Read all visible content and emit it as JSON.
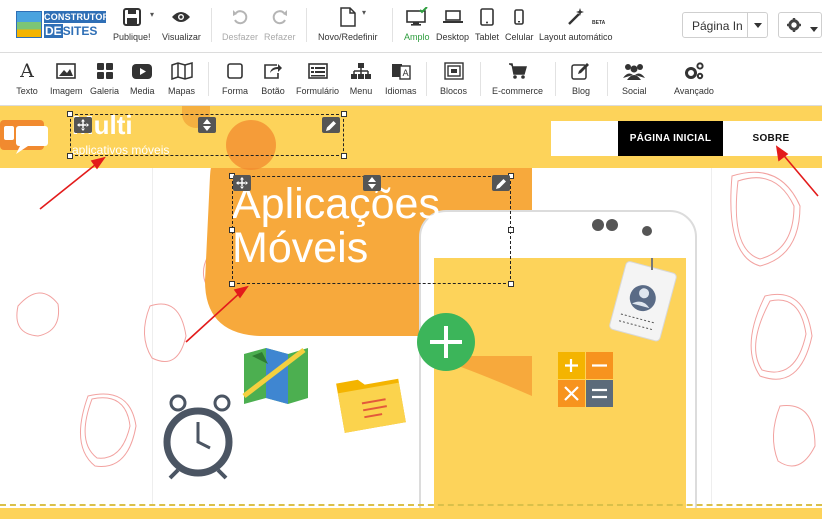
{
  "brand": {
    "line1": "CONSTRUTOR",
    "line2_prefix": "DE",
    "line2_suffix": "SITES"
  },
  "toolbar": {
    "publish": "Publique!",
    "preview": "Visualizar",
    "undo": "Desfazer",
    "redo": "Refazer",
    "new_reset": "Novo/Redefinir",
    "wide": "Amplo",
    "desktop": "Desktop",
    "tablet": "Tablet",
    "mobile": "Celular",
    "auto_layout": "Layout automático",
    "beta": "BETA",
    "page_select_value": "Página In"
  },
  "elements_bar": {
    "items": [
      {
        "label": "Texto",
        "icon": "text-icon"
      },
      {
        "label": "Imagem",
        "icon": "image-icon"
      },
      {
        "label": "Galeria",
        "icon": "gallery-icon"
      },
      {
        "label": "Media",
        "icon": "media-icon"
      },
      {
        "label": "Mapas",
        "icon": "map-icon"
      },
      {
        "label": "Forma",
        "icon": "shape-icon"
      },
      {
        "label": "Botão",
        "icon": "button-icon"
      },
      {
        "label": "Formulário",
        "icon": "form-icon"
      },
      {
        "label": "Menu",
        "icon": "menu-icon"
      },
      {
        "label": "Idiomas",
        "icon": "language-icon"
      },
      {
        "label": "Blocos",
        "icon": "blocks-icon"
      },
      {
        "label": "E-commerce",
        "icon": "cart-icon"
      },
      {
        "label": "Blog",
        "icon": "blog-icon"
      },
      {
        "label": "Social",
        "icon": "social-icon"
      },
      {
        "label": "Avançado",
        "icon": "gears-icon"
      }
    ]
  },
  "site": {
    "title": "Multi",
    "subtitle": "aplicativos móveis",
    "nav": {
      "home": "PÁGINA INICIAL",
      "about": "SOBRE"
    },
    "hero_title_line1": "Aplicações",
    "hero_title_line2": "Móveis"
  },
  "colors": {
    "header_yellow": "#fdd35a",
    "bubble_orange": "#f7a93c",
    "active_green": "#2e9e3e",
    "nav_black": "#000000",
    "arrow_red": "#e31b1b",
    "plus_green": "#3cb55a"
  }
}
